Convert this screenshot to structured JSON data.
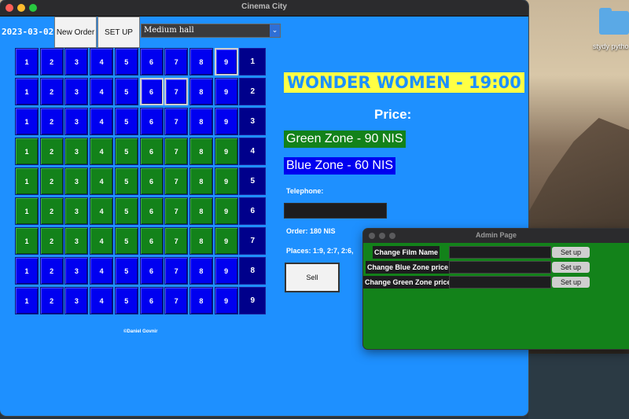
{
  "window": {
    "title": "Cinema City"
  },
  "toolbar": {
    "date": "2023-03-02",
    "new_order_label": "New Order",
    "setup_label": "SET UP",
    "hall_value": "Medium hall"
  },
  "seats": {
    "row_zones": [
      "blue",
      "blue",
      "blue",
      "green",
      "green",
      "green",
      "green",
      "blue",
      "blue"
    ],
    "seat_labels": [
      "1",
      "2",
      "3",
      "4",
      "5",
      "6",
      "7",
      "8",
      "9"
    ],
    "row_labels": [
      "1",
      "2",
      "3",
      "4",
      "5",
      "6",
      "7",
      "8",
      "9"
    ],
    "selected": [
      [
        1,
        9
      ],
      [
        2,
        6
      ],
      [
        2,
        7
      ]
    ]
  },
  "credit": "©Daniel Govnir",
  "info": {
    "film": "WONDER WOMEN - 19:00",
    "price_label": "Price:",
    "green_zone": "Green Zone - 90 NIS",
    "blue_zone": "Blue Zone - 60 NIS",
    "telephone_label": "Telephone:",
    "order": "Order: 180 NIS",
    "places": "Places: 1:9, 2:7, 2:6,",
    "sell_label": "Sell"
  },
  "admin": {
    "title": "Admin Page",
    "rows": [
      {
        "label": "Change Film Name",
        "button": "Set up"
      },
      {
        "label": "Change Blue Zone price",
        "button": "Set up"
      },
      {
        "label": "Change Green Zone price",
        "button": "Set up"
      }
    ]
  },
  "desktop": {
    "folder_label": "stydy pytho"
  },
  "colors": {
    "window_bg": "#1e90ff",
    "blue_seat": "#0000f0",
    "green_seat": "#13821a",
    "row_number_bg": "#00008b",
    "film_bg": "#ffff44"
  }
}
